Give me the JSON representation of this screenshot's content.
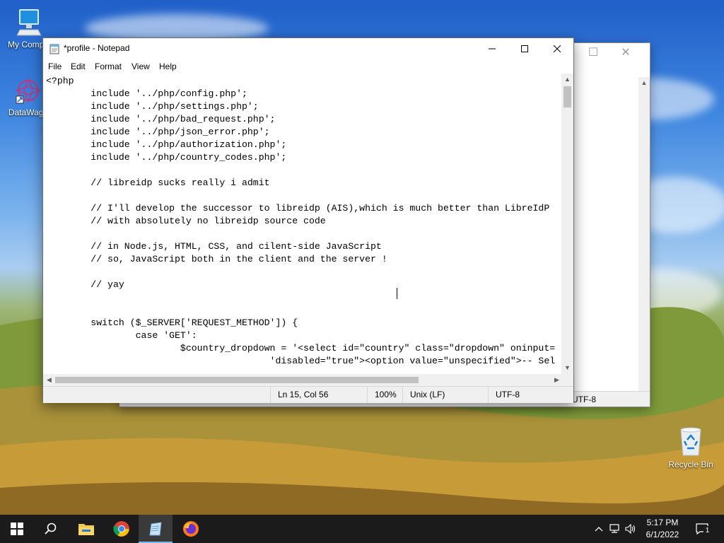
{
  "desktop": {
    "icons": [
      {
        "label": "My Compu",
        "icon": "computer-icon"
      },
      {
        "label": "DataWago",
        "icon": "datawagon-icon"
      }
    ],
    "recycle_bin": {
      "label": "Recycle Bin",
      "icon": "recycle-bin-icon"
    }
  },
  "background_window": {
    "encoding": "UTF-8"
  },
  "notepad": {
    "title": "*profile - Notepad",
    "menu": [
      "File",
      "Edit",
      "Format",
      "View",
      "Help"
    ],
    "lines": [
      "<?php",
      "        include '../php/config.php';",
      "        include '../php/settings.php';",
      "        include '../php/bad_request.php';",
      "        include '../php/json_error.php';",
      "        include '../php/authorization.php';",
      "        include '../php/country_codes.php';",
      "",
      "        // libreidp sucks really i admit",
      "",
      "        // I'll develop the successor to libreidp (AIS),which is much better than LibreIdP",
      "        // with absolutely no libreidp source code",
      "",
      "        // in Node.js, HTML, CSS, and cilent-side JavaScript",
      "        // so, JavaScript both in the client and the server ! ",
      "",
      "        // yay",
      "",
      "",
      "        switch ($_SERVER['REQUEST_METHOD']) {",
      "                case 'GET':",
      "                        $country_dropdown = '<select id=\"country\" class=\"dropdown\" oninput=",
      "                                        'disabled=\"true\"><option value=\"unspecified\">-- Sel"
    ],
    "status": {
      "position": "Ln 15, Col 56",
      "zoom": "100%",
      "line_endings": "Unix (LF)",
      "encoding": "UTF-8"
    }
  },
  "taskbar": {
    "apps": [
      "start-icon",
      "search-icon",
      "file-explorer-icon",
      "chrome-icon",
      "notepad-icon",
      "firefox-icon"
    ],
    "clock": {
      "time": "5:17 PM",
      "date": "6/1/2022"
    },
    "notification_count": "1"
  }
}
